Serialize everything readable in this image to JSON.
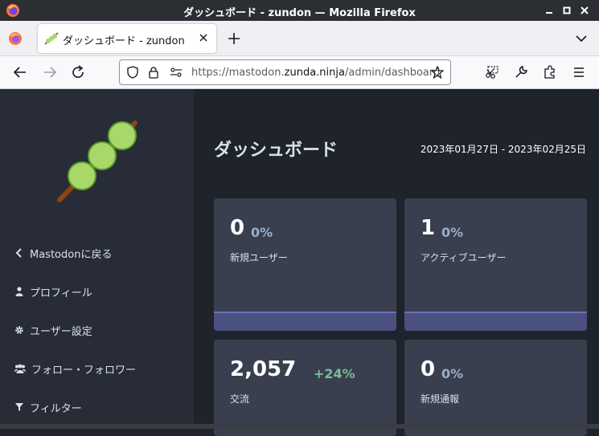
{
  "window": {
    "title": "ダッシュボード - zundon — Mozilla Firefox"
  },
  "tab": {
    "title": "ダッシュボード - zundon"
  },
  "navbar": {
    "url_prefix": "https://mastodon.",
    "url_host": "zunda.ninja",
    "url_path": "/admin/dashboard"
  },
  "sidebar": {
    "items": [
      {
        "label": "Mastodonに戻る",
        "icon": "chevron-left-icon"
      },
      {
        "label": "プロフィール",
        "icon": "user-icon"
      },
      {
        "label": "ユーザー設定",
        "icon": "gear-icon"
      },
      {
        "label": "フォロー・フォロワー",
        "icon": "users-icon"
      },
      {
        "label": "フィルター",
        "icon": "filter-icon"
      }
    ]
  },
  "main": {
    "title": "ダッシュボード",
    "date_range": "2023年01月27日 - 2023年02月25日",
    "cards": [
      {
        "value": "0",
        "change": "0%",
        "label": "新規ユーザー"
      },
      {
        "value": "1",
        "change": "0%",
        "label": "アクティブユーザー"
      },
      {
        "value": "2,057",
        "change": "+24%",
        "label": "交流"
      },
      {
        "value": "0",
        "change": "0%",
        "label": "新規通報"
      }
    ]
  },
  "colors": {
    "sidebar_bg": "#282c37",
    "main_bg": "#1f232b",
    "card_bg": "#393f4f",
    "positive_change": "#79bd9a",
    "neutral_change": "#9baec8",
    "dango_green": "#a8d86a",
    "skewer_brown": "#8b4513"
  }
}
